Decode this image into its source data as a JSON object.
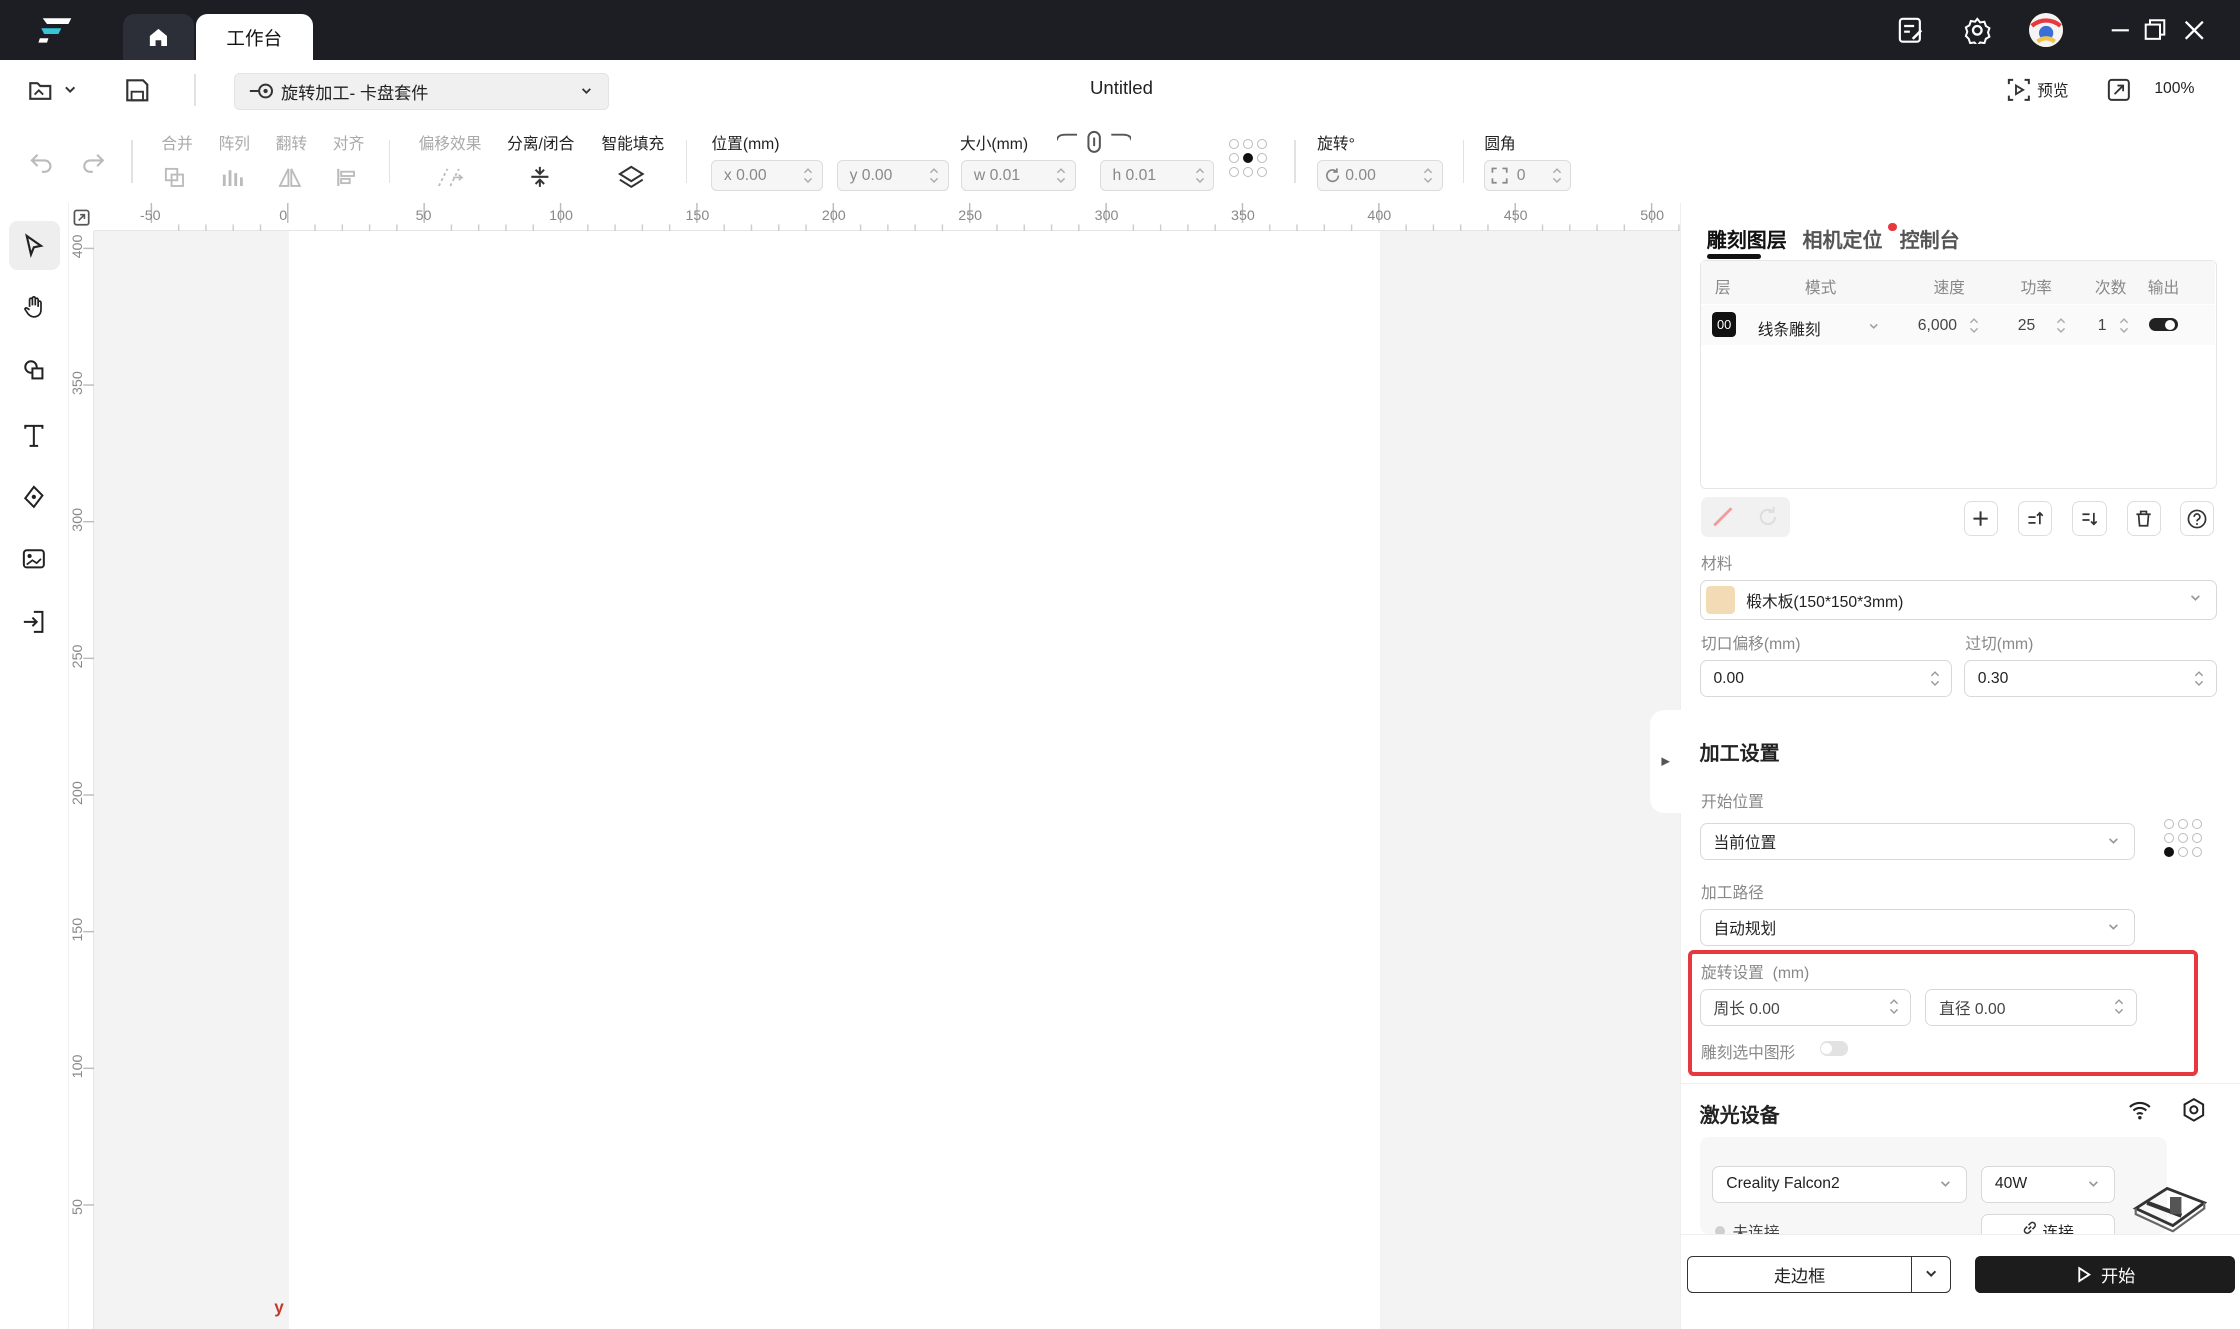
{
  "titlebar": {
    "workspace_tab": "工作台"
  },
  "toolbar": {
    "project_mode": "旋转加工- 卡盘套件",
    "document_title": "Untitled",
    "preview_label": "预览",
    "zoom": "100%"
  },
  "edit_tools": {
    "merge": "合并",
    "array": "阵列",
    "flip": "翻转",
    "align": "对齐",
    "offset": "偏移效果",
    "split_close": "分离/闭合",
    "smart_fill": "智能填充",
    "position_label": "位置(mm)",
    "x": "x 0.00",
    "y": "y 0.00",
    "size_label": "大小(mm)",
    "w": "w 0.01",
    "h": "h 0.01",
    "rotate_label": "旋转°",
    "rotate": "0.00",
    "corner_label": "圆角",
    "corner": "0"
  },
  "ruler": {
    "h_ticks": [
      "-50",
      "0",
      "50",
      "100",
      "150",
      "200",
      "250",
      "300",
      "350",
      "400",
      "450",
      "500"
    ],
    "v_ticks": [
      "400",
      "350",
      "300",
      "250",
      "200",
      "150",
      "100",
      "50"
    ],
    "y_axis": "y"
  },
  "panel": {
    "tabs": [
      "雕刻图层",
      "相机定位",
      "控制台"
    ],
    "layer_headers": [
      "层",
      "模式",
      "速度",
      "功率",
      "次数",
      "输出"
    ],
    "layers": [
      {
        "id": "00",
        "mode": "线条雕刻",
        "speed": "6,000",
        "power": "25",
        "passes": "1"
      }
    ],
    "material_label": "材料",
    "material": "椴木板(150*150*3mm)",
    "kerf_label": "切口偏移(mm)",
    "kerf": "0.00",
    "overcut_label": "过切(mm)",
    "overcut": "0.30",
    "process_title": "加工设置",
    "start_pos_label": "开始位置",
    "start_pos": "当前位置",
    "path_label": "加工路径",
    "path": "自动规划",
    "rotary_label": "旋转设置",
    "rotary_unit": "(mm)",
    "circumference": "周长 0.00",
    "diameter": "直径 0.00",
    "engrave_selected": "雕刻选中图形",
    "laser_title": "激光设备",
    "device": "Creality Falcon2",
    "power": "40W",
    "status": "未连接",
    "connect": "连接",
    "frame_btn": "走边框",
    "start_btn": "开始"
  },
  "colors": {
    "accent": "#111111",
    "highlight": "#e5393f",
    "titlebar": "#1c1e24",
    "notify_dot": "#e5393f"
  }
}
